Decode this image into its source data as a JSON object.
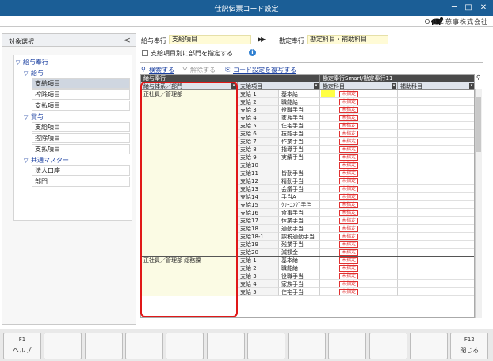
{
  "window": {
    "title": "仕訳伝票コード設定",
    "company": "ＯＢＣ慈事株式会社"
  },
  "left_panel": {
    "title": "対象選択",
    "collapse_glyph": "<",
    "tree": [
      {
        "label": "給与奉行",
        "level": 0,
        "expander": "▽",
        "blue": true
      },
      {
        "label": "給与",
        "level": 1,
        "expander": "▽",
        "blue": true
      },
      {
        "label": "支給項目",
        "level": 2,
        "selected": true
      },
      {
        "label": "控除項目",
        "level": 2
      },
      {
        "label": "支払項目",
        "level": 2
      },
      {
        "label": "賞与",
        "level": 1,
        "expander": "▽",
        "blue": true
      },
      {
        "label": "支給項目",
        "level": 2
      },
      {
        "label": "控除項目",
        "level": 2
      },
      {
        "label": "支払項目",
        "level": 2
      },
      {
        "label": "共通マスター",
        "level": 1,
        "expander": "▽",
        "blue": true
      },
      {
        "label": "法人口座",
        "level": 2
      },
      {
        "label": "部門",
        "level": 2
      }
    ]
  },
  "top": {
    "source_label": "給与奉行",
    "source_value": "支給項目",
    "arrows": "▶▶",
    "target_label": "勘定奉行",
    "target_value": "勘定科目・補助科目",
    "dept_checkbox_label": "支給項目別に部門を指定する",
    "info_icon": "i"
  },
  "toolbar": {
    "search": "検索する",
    "clear": "解除する",
    "copy": "コード設定を複写する"
  },
  "grid": {
    "group_left": "給与奉行",
    "group_right": "勘定奉行Smart/勘定奉行11",
    "col_dept": "給与体系／部門",
    "col_item": "支給項目",
    "col_account": "勘定科目",
    "col_sub": "補助科目",
    "unset": "未指定",
    "sections": [
      {
        "dept": "正社員／管理部",
        "rows": [
          {
            "code": "支給 1",
            "name": "基本給"
          },
          {
            "code": "支給 2",
            "name": "職能給"
          },
          {
            "code": "支給 3",
            "name": "役職手当"
          },
          {
            "code": "支給 4",
            "name": "家族手当"
          },
          {
            "code": "支給 5",
            "name": "住宅手当"
          },
          {
            "code": "支給 6",
            "name": "技能手当"
          },
          {
            "code": "支給 7",
            "name": "作業手当"
          },
          {
            "code": "支給 8",
            "name": "指導手当"
          },
          {
            "code": "支給 9",
            "name": "実績手当"
          },
          {
            "code": "支給10",
            "name": ""
          },
          {
            "code": "支給11",
            "name": "皆勤手当"
          },
          {
            "code": "支給12",
            "name": "精勤手当"
          },
          {
            "code": "支給13",
            "name": "会議手当"
          },
          {
            "code": "支給14",
            "name": "手当A"
          },
          {
            "code": "支給15",
            "name": "ｸﾘｰﾆﾝｸﾞ手当"
          },
          {
            "code": "支給16",
            "name": "食事手当"
          },
          {
            "code": "支給17",
            "name": "休業手当"
          },
          {
            "code": "支給18",
            "name": "通勤手当"
          },
          {
            "code": "支給18-1",
            "name": "課税通勤手当"
          },
          {
            "code": "支給19",
            "name": "残業手当"
          },
          {
            "code": "支給20",
            "name": "減額金"
          }
        ]
      },
      {
        "dept": "正社員／管理部 総務課",
        "rows": [
          {
            "code": "支給 1",
            "name": "基本給"
          },
          {
            "code": "支給 2",
            "name": "職能給"
          },
          {
            "code": "支給 3",
            "name": "役職手当"
          },
          {
            "code": "支給 4",
            "name": "家族手当"
          },
          {
            "code": "支給 5",
            "name": "住宅手当"
          }
        ]
      }
    ]
  },
  "footer": {
    "keys": [
      {
        "key": "F1",
        "label": "ヘルプ"
      },
      {
        "key": "",
        "label": ""
      },
      {
        "key": "",
        "label": ""
      },
      {
        "key": "",
        "label": ""
      },
      {
        "key": "",
        "label": ""
      },
      {
        "key": "",
        "label": ""
      },
      {
        "key": "",
        "label": ""
      },
      {
        "key": "",
        "label": ""
      },
      {
        "key": "",
        "label": ""
      },
      {
        "key": "",
        "label": ""
      },
      {
        "key": "",
        "label": ""
      },
      {
        "key": "F12",
        "label": "閉じる"
      }
    ]
  }
}
